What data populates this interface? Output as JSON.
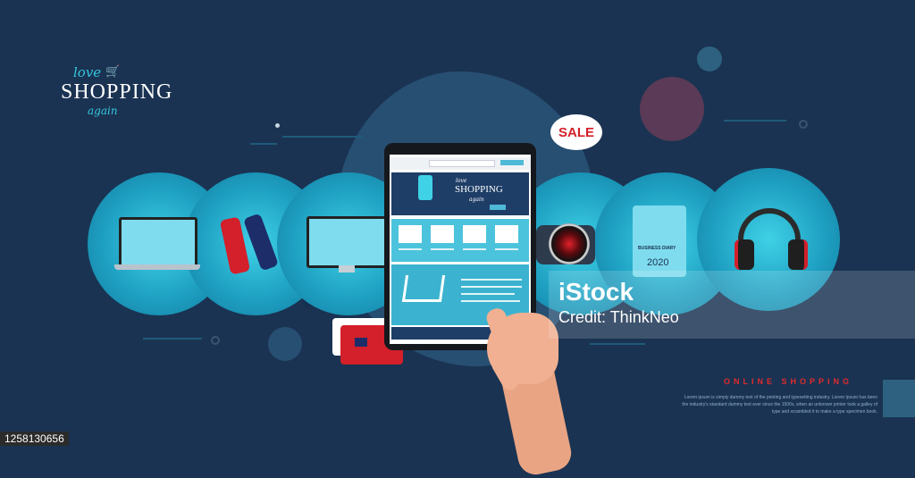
{
  "logo": {
    "love": "love",
    "main": "SHOPPING",
    "again": "again",
    "cart_icon": "shopping-cart-icon"
  },
  "tablet": {
    "hero": {
      "love": "love",
      "main": "SHOPPING",
      "again": "again"
    },
    "product_icons": [
      "camera-icon",
      "headphones-icon",
      "usb-icon",
      "phone-icon"
    ]
  },
  "sale_label": "SALE",
  "diary": {
    "title": "BUSINESS DIARY",
    "year": "2020"
  },
  "watermark": {
    "logo": "iStock",
    "credit": "Credit: ThinkNeo"
  },
  "online_shopping": {
    "title": "ONLINE SHOPPING",
    "body": "Lorem ipsum is simply dummy text of the printing and typesetting industry. Lorem Ipsum has been the industry's standard dummy text ever since the 1500s, when an unknown printer took a galley of type and scrambled it to make a type specimen book."
  },
  "image_id": "1258130656",
  "colors": {
    "background": "#1a3352",
    "accent": "#3fd1e6",
    "brand_red": "#d3202a"
  }
}
